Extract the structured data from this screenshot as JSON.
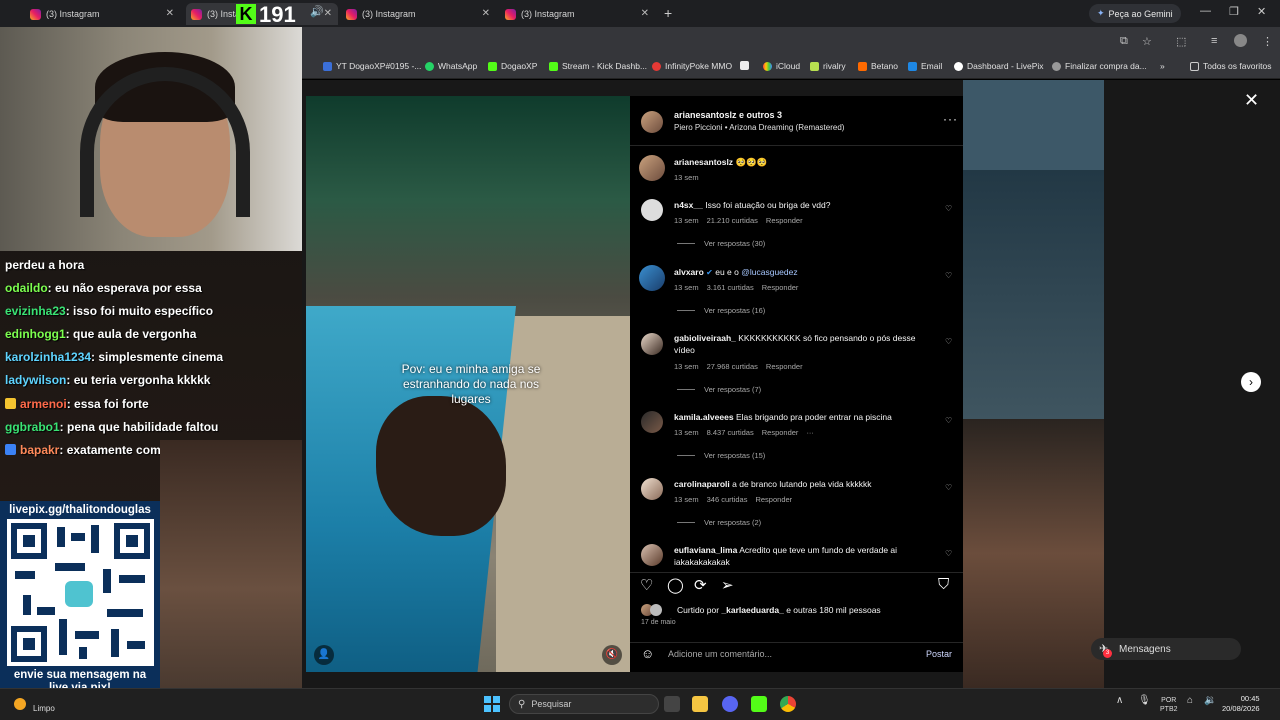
{
  "browser": {
    "tabs": [
      {
        "label": "(3) Instagram"
      },
      {
        "label": "(3) Instagr"
      },
      {
        "label": "(3) Instagram"
      },
      {
        "label": "(3) Instagram"
      }
    ],
    "gemini_label": "Peça ao Gemini",
    "bookmarks": [
      "YT DogaoXP#0195 -...",
      "WhatsApp",
      "DogaoXP",
      "Stream - Kick Dashb...",
      "InfinityPoke MMO",
      "iCloud",
      "rivalry",
      "Betano",
      "Email",
      "Dashboard - LivePix",
      "Finalizar compra da...",
      "Todos os favoritos"
    ]
  },
  "stream": {
    "viewer_count": "191",
    "chat": [
      {
        "user": "",
        "message": "perdeu a hora"
      },
      {
        "user": "odaildo",
        "message": ": eu não esperava por essa"
      },
      {
        "user": "evizinha23",
        "message": ": isso foi muito específico"
      },
      {
        "user": "edinhogg1",
        "message": ": que aula de vergonha"
      },
      {
        "user": "karolzinha1234",
        "message": ": simplesmente cinema"
      },
      {
        "user": "ladywilson",
        "message": ": eu teria vergonha kkkkk"
      },
      {
        "user": "armenoi",
        "message": ": essa foi forte"
      },
      {
        "user": "ggbrabo1",
        "message": ": pena que habilidade faltou"
      },
      {
        "user": "bapakr",
        "message": ": exatamente como esperado"
      }
    ],
    "livepix_url": "livepix.gg/thalitondouglas",
    "livepix_msg_1": "envie sua mensagem na",
    "livepix_msg_2": "live via pix!"
  },
  "post": {
    "video_caption": "Pov: eu e minha amiga se estranhando do nada nos lugares",
    "header_user": "arianesantoslz e outros 3",
    "song_artist": "Piero Piccioni",
    "song_sep": "•",
    "song_title": "Arizona Dreaming (Remastered)",
    "caption_user": "arianesantoslz",
    "caption_emoji": "🥺🥺🥺",
    "caption_time": "13 sem",
    "comments": [
      {
        "user": "n4sx__",
        "text": "Isso foi atuação ou briga de vdd?",
        "time": "13 sem",
        "likes": "21.210 curtidas",
        "reply": "Responder",
        "replies": "Ver respostas (30)"
      },
      {
        "user": "alvxaro",
        "text_pre": "eu e o",
        "mention": "@lucasguedez",
        "time": "13 sem",
        "likes": "3.161 curtidas",
        "reply": "Responder",
        "replies": "Ver respostas (16)"
      },
      {
        "user": "gabioliveiraah_",
        "text": "KKKKKKKKKKK só fico pensando o pós desse vídeo",
        "time": "13 sem",
        "likes": "27.968 curtidas",
        "reply": "Responder",
        "replies": "Ver respostas (7)"
      },
      {
        "user": "kamila.alveees",
        "text": "Elas brigando pra poder entrar na piscina",
        "time": "13 sem",
        "likes": "8.437 curtidas",
        "reply": "Responder",
        "replies": "Ver respostas (15)"
      },
      {
        "user": "carolinaparoli",
        "text": "a de branco lutando pela vida kkkkkk",
        "time": "13 sem",
        "likes": "346 curtidas",
        "reply": "Responder",
        "replies": "Ver respostas (2)"
      },
      {
        "user": "euflaviana_lima",
        "text": "Acredito que teve um fundo de verdade ai iakakakakakak"
      }
    ],
    "liked_by_pre": "Curtido por",
    "liked_by_user": "_karlaeduarda_",
    "liked_by_post": "e outras 180 mil pessoas",
    "post_date": "17 de maio",
    "comment_placeholder": "Adicione um comentário...",
    "post_button": "Postar",
    "messages_label": "Mensagens",
    "messages_badge": "3"
  },
  "taskbar": {
    "weather": "Limpo",
    "search_placeholder": "Pesquisar",
    "lang_1": "POR",
    "lang_2": "PTB2",
    "time": "00:45",
    "date": "20/08/2026"
  }
}
